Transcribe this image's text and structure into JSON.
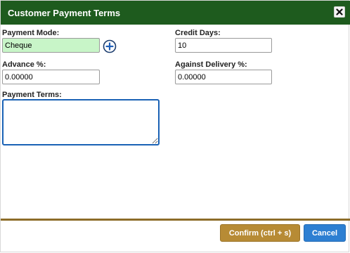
{
  "dialog": {
    "title": "Customer Payment Terms",
    "close_icon": "close-x-icon"
  },
  "form": {
    "payment_mode": {
      "label": "Payment Mode:",
      "value": "Cheque",
      "add_icon": "plus-circle-icon"
    },
    "credit_days": {
      "label": "Credit Days:",
      "value": "10"
    },
    "advance": {
      "label": "Advance %:",
      "value": "0.00000"
    },
    "against_delivery": {
      "label": "Against Delivery %:",
      "value": "0.00000"
    },
    "payment_terms": {
      "label": "Payment Terms:",
      "value": ""
    }
  },
  "footer": {
    "confirm_label": "Confirm (ctrl + s)",
    "cancel_label": "Cancel"
  },
  "colors": {
    "title_bar": "#1e5b1e",
    "payment_mode_bg": "#c8f5c8",
    "divider": "#8d6d29",
    "confirm_button": "#b78b35",
    "cancel_button": "#2d7fd2",
    "focus_border": "#1a62b5"
  }
}
